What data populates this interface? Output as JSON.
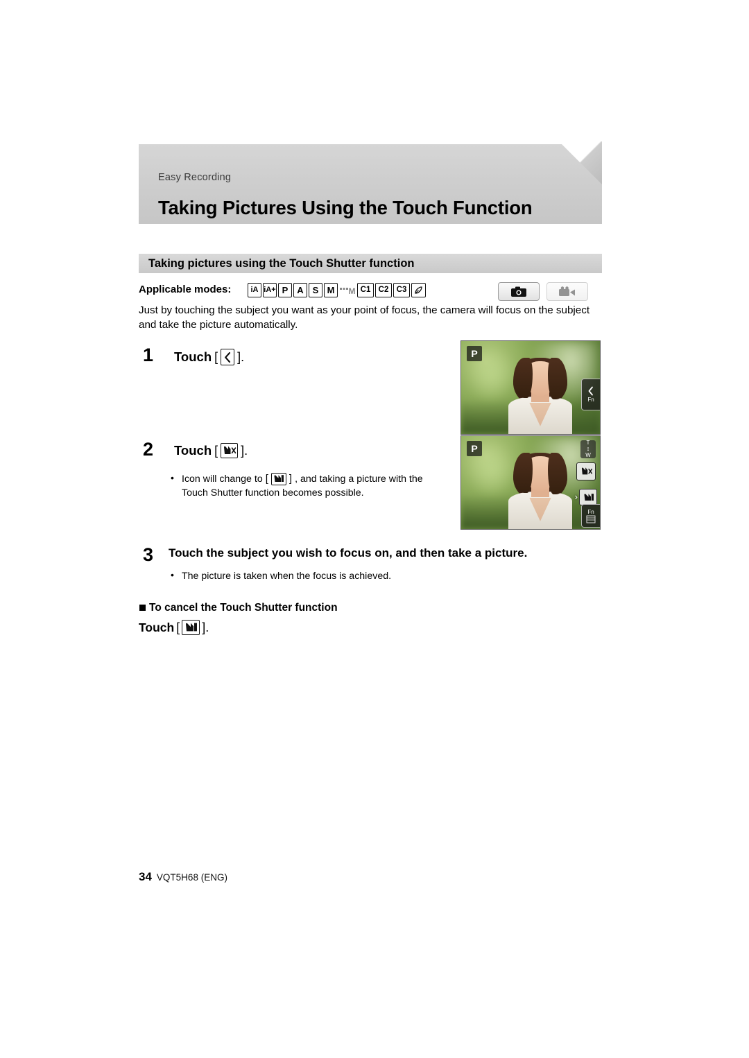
{
  "page": {
    "eyebrow": "Easy Recording",
    "chapter_title": "Taking Pictures Using the Touch Function",
    "section_title": "Taking pictures using the Touch Shutter function",
    "footer_page": "34",
    "footer_code": "VQT5H68 (ENG)"
  },
  "modes": {
    "label": "Applicable modes:",
    "items": [
      {
        "name": "mode-intelligent-auto",
        "text": "iA",
        "type": "box"
      },
      {
        "name": "mode-intelligent-auto-plus",
        "text": "iA+",
        "type": "box"
      },
      {
        "name": "mode-program-ae",
        "text": "P",
        "type": "box"
      },
      {
        "name": "mode-aperture-priority",
        "text": "A",
        "type": "box"
      },
      {
        "name": "mode-shutter-priority",
        "text": "S",
        "type": "box"
      },
      {
        "name": "mode-manual",
        "text": "M",
        "type": "box"
      },
      {
        "name": "mode-creative-video",
        "text": "M",
        "type": "plain"
      },
      {
        "name": "mode-custom-c1",
        "text": "C1",
        "type": "wide"
      },
      {
        "name": "mode-custom-c2",
        "text": "C2",
        "type": "wide"
      },
      {
        "name": "mode-custom-c3",
        "text": "C3",
        "type": "wide"
      },
      {
        "name": "mode-creative-control",
        "text": "",
        "type": "creative"
      }
    ],
    "right_icons": [
      {
        "name": "photo-mode-pill",
        "icon": "camera-icon",
        "state": "active"
      },
      {
        "name": "video-mode-pill",
        "icon": "video-camera-icon",
        "state": "dimmed"
      }
    ]
  },
  "intro": "Just by touching the subject you want as your point of focus, the camera will focus on the subject and take the picture automatically.",
  "steps": [
    {
      "number": "1",
      "prefix": "Touch",
      "icon": "touch-tab-arrow-icon",
      "suffix": "."
    },
    {
      "number": "2",
      "prefix": "Touch",
      "icon": "touch-shutter-off-icon",
      "suffix": ".",
      "bullets": [
        {
          "pre": "Icon will change to",
          "icon": "touch-shutter-on-icon",
          "post": ", and taking a picture with the",
          "line2": "Touch Shutter function becomes possible."
        }
      ]
    },
    {
      "number": "3",
      "text": "Touch the subject you wish to focus on, and then take a picture.",
      "bullets": [
        {
          "text": "The picture is taken when the focus is achieved."
        }
      ]
    }
  ],
  "cancel": {
    "heading": "To cancel the Touch Shutter function",
    "touch_prefix": "Touch",
    "icon": "touch-shutter-on-icon",
    "touch_suffix": "."
  },
  "screenshots": [
    {
      "name": "camera-screen-step1",
      "mode_badge": "P",
      "fn_label": "Fn",
      "tab_icon": "left-arrow-tab-icon"
    },
    {
      "name": "camera-screen-step2",
      "mode_badge": "P",
      "fn_label": "Fn",
      "zoom_top": "T",
      "zoom_bottom": "W",
      "chip_icon": "touch-shutter-off-icon"
    }
  ]
}
